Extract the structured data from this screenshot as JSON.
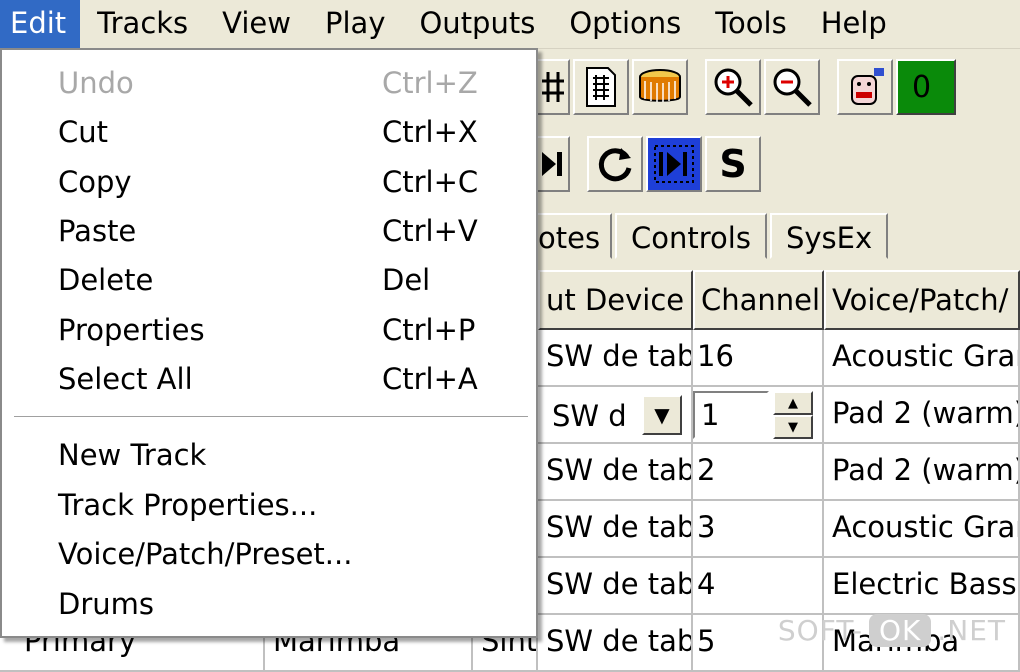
{
  "menubar": {
    "items": [
      "Edit",
      "Tracks",
      "View",
      "Play",
      "Outputs",
      "Options",
      "Tools",
      "Help"
    ]
  },
  "edit_menu": {
    "items": [
      {
        "label": "Undo",
        "shortcut": "Ctrl+Z"
      },
      {
        "label": "Cut",
        "shortcut": "Ctrl+X"
      },
      {
        "label": "Copy",
        "shortcut": "Ctrl+C"
      },
      {
        "label": "Paste",
        "shortcut": "Ctrl+V"
      },
      {
        "label": "Delete",
        "shortcut": "Del"
      },
      {
        "label": "Properties",
        "shortcut": "Ctrl+P"
      },
      {
        "label": "Select All",
        "shortcut": "Ctrl+A"
      },
      {
        "label": "New Track",
        "shortcut": ""
      },
      {
        "label": "Track Properties...",
        "shortcut": ""
      },
      {
        "label": "Voice/Patch/Preset...",
        "shortcut": ""
      },
      {
        "label": "Drums",
        "shortcut": ""
      }
    ]
  },
  "toolbar": {
    "green_label": "0",
    "loop_glyph": "C",
    "s_glyph": "S"
  },
  "tabs": [
    "otes",
    "Controls",
    "SysEx"
  ],
  "grid": {
    "headers": [
      "ut Device",
      "Channel",
      "Voice/Patch/"
    ],
    "rows": [
      {
        "device": "SW de tab",
        "channel": "16",
        "voice": "Acoustic Gran"
      },
      {
        "device": "SW d",
        "channel": "1",
        "voice": "Pad 2 (warm)"
      },
      {
        "device": "SW de tab",
        "channel": "2",
        "voice": "Pad 2 (warm)"
      },
      {
        "device": "SW de tab",
        "channel": "3",
        "voice": "Acoustic Gran"
      },
      {
        "device": "SW de tab",
        "channel": "4",
        "voice": "Electric Bass"
      },
      {
        "device": "SW de tab",
        "channel": "5",
        "voice": "Marimba",
        "name": "Primary",
        "instrument": "Marimba",
        "type": "Sint"
      }
    ]
  },
  "watermark": {
    "left": "SOFT-",
    "mid": "OK",
    "right": ".NET"
  }
}
